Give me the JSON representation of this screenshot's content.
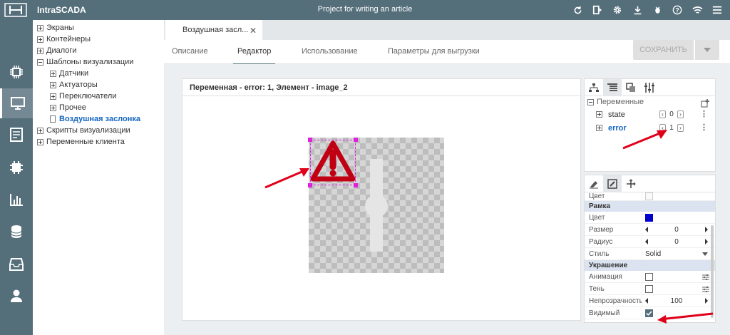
{
  "app": {
    "name": "IntraSCADA",
    "project_title": "Project for writing an article"
  },
  "topbar_icons": [
    "refresh-icon",
    "tablet-icon",
    "gear-icon",
    "download-icon",
    "bug-icon",
    "help-icon",
    "wifi-icon",
    "menu-icon"
  ],
  "sidebar_icons": [
    "chip-icon",
    "monitor-icon",
    "document-icon",
    "component-icon",
    "chart-icon",
    "database-icon",
    "archive-icon",
    "user-icon"
  ],
  "tree": {
    "items": [
      {
        "label": "Экраны",
        "level": 0,
        "toggle": "plus"
      },
      {
        "label": "Контейнеры",
        "level": 0,
        "toggle": "plus"
      },
      {
        "label": "Диалоги",
        "level": 0,
        "toggle": "plus"
      },
      {
        "label": "Шаблоны визуализации",
        "level": 0,
        "toggle": "minus"
      },
      {
        "label": "Датчики",
        "level": 1,
        "toggle": "plus"
      },
      {
        "label": "Актуаторы",
        "level": 1,
        "toggle": "plus"
      },
      {
        "label": "Переключатели",
        "level": 1,
        "toggle": "plus"
      },
      {
        "label": "Прочее",
        "level": 1,
        "toggle": "plus"
      },
      {
        "label": "Воздушная заслонка",
        "level": 1,
        "toggle": "doc",
        "selected": true
      },
      {
        "label": "Скрипты визуализации",
        "level": 0,
        "toggle": "plus"
      },
      {
        "label": "Переменные клиента",
        "level": 0,
        "toggle": "plus"
      }
    ]
  },
  "file_tab": {
    "label": "Воздушная засл...",
    "close": "✕"
  },
  "subtabs": [
    {
      "label": "Описание",
      "active": false
    },
    {
      "label": "Редактор",
      "active": true
    },
    {
      "label": "Использование",
      "active": false
    },
    {
      "label": "Параметры для выгрузки",
      "active": false
    }
  ],
  "save_button": {
    "label": "СОХРАНИТЬ"
  },
  "canvas": {
    "header": "Переменная - error: 1, Элемент - image_2"
  },
  "variables": {
    "header": "Переменные",
    "items": [
      {
        "name": "state",
        "value": "0",
        "highlight": false
      },
      {
        "name": "error",
        "value": "1",
        "highlight": true
      }
    ]
  },
  "properties": {
    "top_row": {
      "label": "Цвет"
    },
    "groups": [
      {
        "title": "Рамка",
        "rows": [
          {
            "label": "Цвет",
            "kind": "color",
            "color": "#0000cc"
          },
          {
            "label": "Размер",
            "kind": "number",
            "value": "0"
          },
          {
            "label": "Радиус",
            "kind": "number",
            "value": "0"
          },
          {
            "label": "Стиль",
            "kind": "select",
            "value": "Solid"
          }
        ]
      },
      {
        "title": "Украшение",
        "rows": [
          {
            "label": "Анимация",
            "kind": "check",
            "checked": false
          },
          {
            "label": "Тень",
            "kind": "check",
            "checked": false
          },
          {
            "label": "Непрозрачность",
            "kind": "number",
            "value": "100"
          },
          {
            "label": "Видимый",
            "kind": "check",
            "checked": true
          }
        ]
      }
    ]
  },
  "colors": {
    "bar": "#546e7a",
    "accent": "#1565c0",
    "warning": "#d0021b",
    "selection": "#e020e0"
  }
}
